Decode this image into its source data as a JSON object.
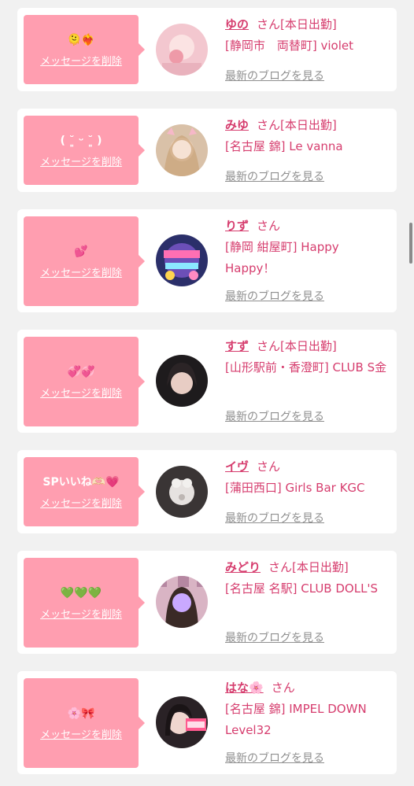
{
  "colors": {
    "accent": "#d63d6e",
    "bubble": "#ff9eb0",
    "blog_link": "#8f8f8f"
  },
  "cards": [
    {
      "stamp": "🫠❤️‍🔥",
      "delete_label": "メッセージを削除",
      "name": "ゆの",
      "suffix": "さん[本日出勤]",
      "shop": "[静岡市　両替町] violet",
      "blog_label": "最新のブログを見る"
    },
    {
      "stamp": "( ˘͈ ᵕ ˘͈ )",
      "delete_label": "メッセージを削除",
      "name": "みゆ",
      "suffix": "さん[本日出勤]",
      "shop": "[名古屋 錦] Le vanna",
      "blog_label": "最新のブログを見る"
    },
    {
      "stamp": "💕",
      "delete_label": "メッセージを削除",
      "name": "りず",
      "suffix": "さん",
      "shop": "[静岡 紺屋町] Happy Happy！",
      "blog_label": "最新のブログを見る"
    },
    {
      "stamp": "💞💞",
      "delete_label": "メッセージを削除",
      "name": "すず",
      "suffix": "さん[本日出勤]",
      "shop": "[山形駅前・香澄町] CLUB S金",
      "blog_label": "最新のブログを見る"
    },
    {
      "stamp": "SPいいね🫶🏻💗",
      "delete_label": "メッセージを削除",
      "name": "イヴ",
      "suffix": "さん",
      "shop": "[蒲田西口] Girls Bar KGC",
      "blog_label": "最新のブログを見る"
    },
    {
      "stamp": "💚💚💚",
      "delete_label": "メッセージを削除",
      "name": "みどり",
      "suffix": "さん[本日出勤]",
      "shop": "[名古屋 名駅] CLUB DOLL'S",
      "blog_label": "最新のブログを見る"
    },
    {
      "stamp": "🌸🎀",
      "delete_label": "メッセージを削除",
      "name": "はな🌸",
      "suffix": "さん",
      "shop": "[名古屋 錦] IMPEL DOWN Level32",
      "blog_label": "最新のブログを見る"
    }
  ]
}
